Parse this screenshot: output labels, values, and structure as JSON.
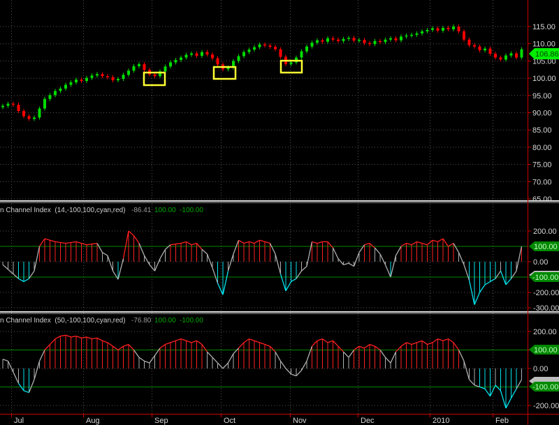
{
  "colors": {
    "background": "#000000",
    "up": "#00dd00",
    "down": "#ff0000",
    "overbought": "#ff2020",
    "oversold": "#00e5ee",
    "neutral": "#b0b0b0",
    "level_line": "#008800",
    "axis": "#cc0000",
    "highlight": "#ffff33"
  },
  "x_axis": {
    "months": [
      "Jul",
      "Aug",
      "Sep",
      "Oct",
      "Nov",
      "Dec",
      "2010",
      "Feb"
    ]
  },
  "chart_data": [
    {
      "type": "candlestick",
      "name": "price",
      "ylim": [
        65,
        115
      ],
      "y_ticks": [
        "115.00",
        "110.00",
        "105.00",
        "100.00",
        "95.00",
        "90.00",
        "85.00",
        "80.00",
        "75.00",
        "70.00",
        "65.00"
      ],
      "last_price": "106.86",
      "close": [
        92.0,
        92.6,
        92.3,
        90.5,
        89.0,
        88.2,
        88.6,
        91.2,
        94.0,
        95.1,
        96.3,
        97.0,
        98.1,
        98.8,
        99.6,
        99.2,
        100.1,
        100.8,
        101.2,
        100.6,
        100.3,
        99.4,
        99.8,
        101.0,
        102.2,
        103.5,
        104.1,
        102.4,
        101.1,
        100.6,
        102.0,
        103.4,
        104.6,
        105.3,
        106.0,
        106.8,
        107.2,
        106.5,
        107.6,
        106.9,
        105.8,
        104.0,
        102.6,
        103.1,
        105.0,
        106.4,
        107.6,
        108.3,
        109.0,
        109.8,
        109.5,
        109.1,
        108.4,
        106.2,
        104.1,
        104.6,
        106.0,
        107.8,
        109.2,
        110.3,
        111.0,
        110.6,
        111.6,
        111.2,
        110.8,
        111.4,
        111.7,
        110.9,
        111.1,
        110.2,
        109.9,
        110.8,
        110.5,
        111.2,
        111.6,
        111.0,
        112.1,
        112.4,
        112.6,
        113.0,
        113.6,
        114.0,
        114.5,
        113.8,
        114.6,
        114.2,
        115.0,
        113.6,
        111.2,
        109.6,
        109.2,
        108.1,
        108.6,
        107.1,
        106.0,
        105.4,
        106.6,
        107.2,
        106.0,
        108.4
      ]
    },
    {
      "type": "histogram-line",
      "name": "cci14",
      "header": {
        "title": "n Channel Index  (14,-100,100,cyan,red)",
        "value": "-86.41",
        "upper": "100.00",
        "lower": "-100.00"
      },
      "ylim": [
        -300,
        250
      ],
      "levels": [
        100,
        -100
      ],
      "y_ticks": [
        "200.00",
        "0.00",
        "-200.00",
        "-300.00"
      ],
      "tags": {
        "upper": "100.00",
        "lower": "-100.00"
      },
      "values": [
        -20,
        -50,
        -80,
        -110,
        -130,
        -110,
        -60,
        100,
        150,
        140,
        130,
        125,
        120,
        125,
        130,
        120,
        110,
        115,
        120,
        60,
        40,
        -60,
        -115,
        20,
        200,
        170,
        120,
        40,
        -20,
        -60,
        20,
        80,
        110,
        115,
        120,
        130,
        110,
        120,
        80,
        50,
        -40,
        -140,
        -215,
        -60,
        50,
        140,
        120,
        130,
        120,
        140,
        130,
        120,
        50,
        -80,
        -190,
        -130,
        -110,
        -60,
        -30,
        130,
        120,
        130,
        130,
        90,
        20,
        -20,
        -10,
        -30,
        60,
        110,
        120,
        90,
        50,
        -20,
        -100,
        40,
        100,
        120,
        110,
        130,
        120,
        110,
        140,
        130,
        150,
        100,
        120,
        60,
        -20,
        -120,
        -280,
        -200,
        -150,
        -130,
        -110,
        -60,
        -150,
        -110,
        -60,
        100
      ]
    },
    {
      "type": "histogram-line",
      "name": "cci50",
      "header": {
        "title": "n Channel Index  (50,-100,100,cyan,red)",
        "value": "-76.80",
        "upper": "100.00",
        "lower": "-100.00"
      },
      "ylim": [
        -230,
        280
      ],
      "levels": [
        100,
        -100
      ],
      "y_ticks": [
        "200.00",
        "100.00",
        "0.00",
        "-200.00"
      ],
      "tags": {
        "upper": "100.00",
        "lower": "-100.00"
      },
      "values": [
        50,
        40,
        -20,
        -80,
        -120,
        -130,
        -60,
        40,
        100,
        130,
        160,
        175,
        180,
        170,
        175,
        165,
        170,
        160,
        165,
        150,
        140,
        120,
        100,
        120,
        130,
        100,
        60,
        40,
        30,
        70,
        110,
        130,
        140,
        150,
        160,
        150,
        140,
        150,
        130,
        90,
        60,
        30,
        0,
        30,
        80,
        110,
        140,
        160,
        150,
        140,
        130,
        120,
        90,
        40,
        0,
        -30,
        -40,
        -10,
        40,
        120,
        150,
        160,
        140,
        150,
        120,
        90,
        60,
        100,
        120,
        110,
        130,
        120,
        100,
        60,
        30,
        90,
        120,
        140,
        130,
        140,
        150,
        130,
        140,
        160,
        150,
        160,
        140,
        100,
        40,
        -60,
        -90,
        -100,
        -110,
        -150,
        -90,
        -120,
        -215,
        -160,
        -110,
        -60
      ]
    }
  ]
}
